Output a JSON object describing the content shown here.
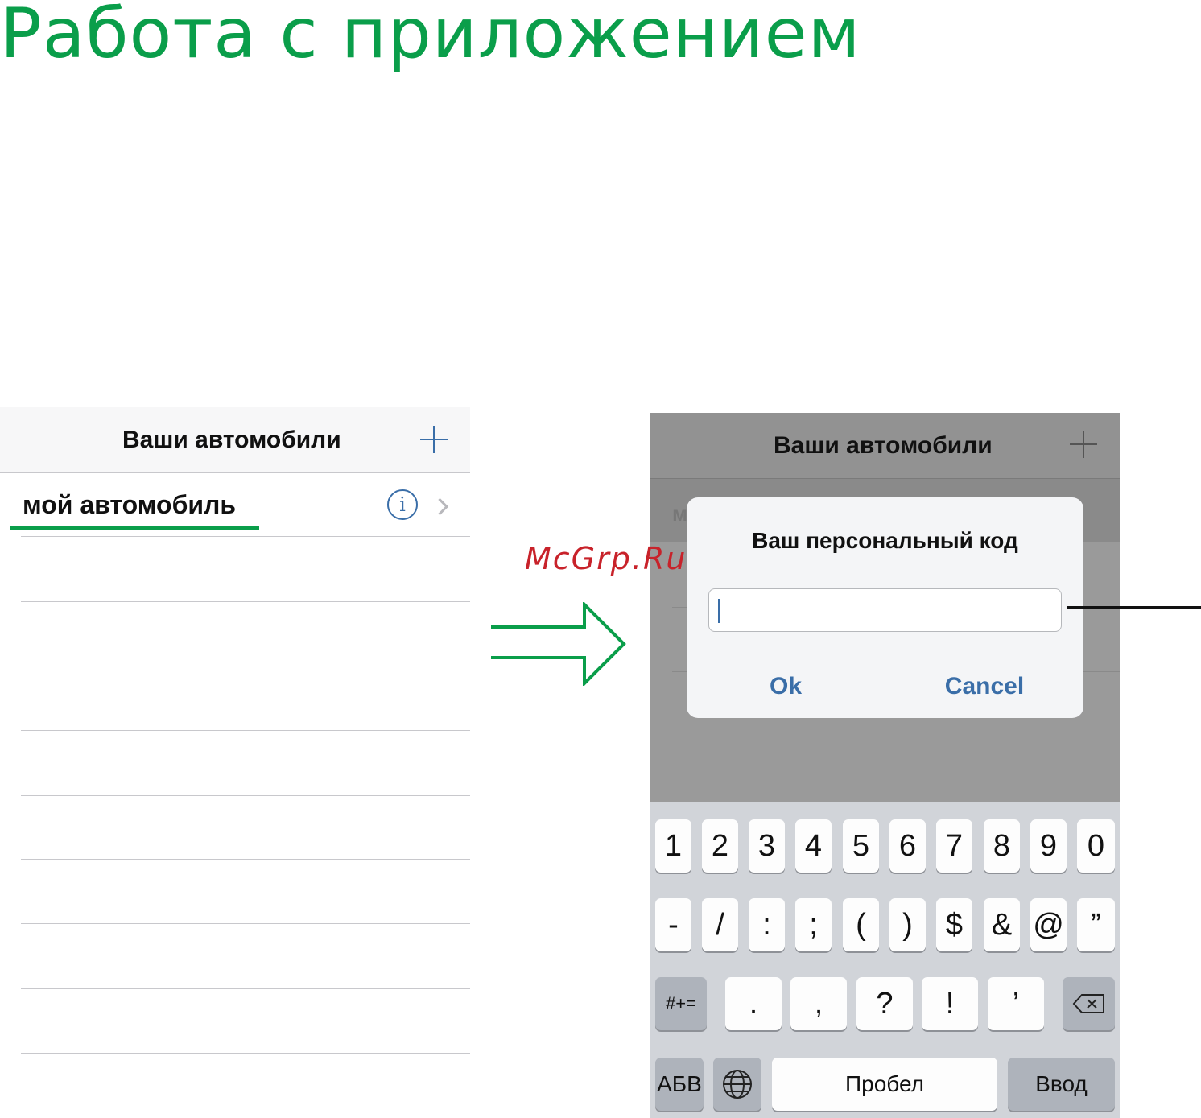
{
  "heading": "Работа с приложением",
  "watermark": "McGrp.Ru",
  "left_screen": {
    "nav_title": "Ваши автомобили",
    "car_name": "мой автомобиль"
  },
  "right_screen": {
    "nav_title": "Ваши автомобили",
    "hidden_row_initial": "м",
    "dialog": {
      "title": "Ваш персональный код",
      "input_value": "",
      "ok_label": "Ok",
      "cancel_label": "Cancel"
    },
    "keyboard": {
      "row1": [
        "1",
        "2",
        "3",
        "4",
        "5",
        "6",
        "7",
        "8",
        "9",
        "0"
      ],
      "row2": [
        "-",
        "/",
        ":",
        ";",
        "(",
        ")",
        "$",
        "&",
        "@",
        "”"
      ],
      "row3_mode": "#+=",
      "row3": [
        ".",
        ",",
        "?",
        "!",
        "’"
      ],
      "abc_label": "АБВ",
      "space_label": "Пробел",
      "return_label": "Ввод"
    }
  },
  "colors": {
    "accent_green": "#0a9e4a",
    "ios_blue": "#3a6ea8",
    "watermark_red": "#c8222a"
  }
}
